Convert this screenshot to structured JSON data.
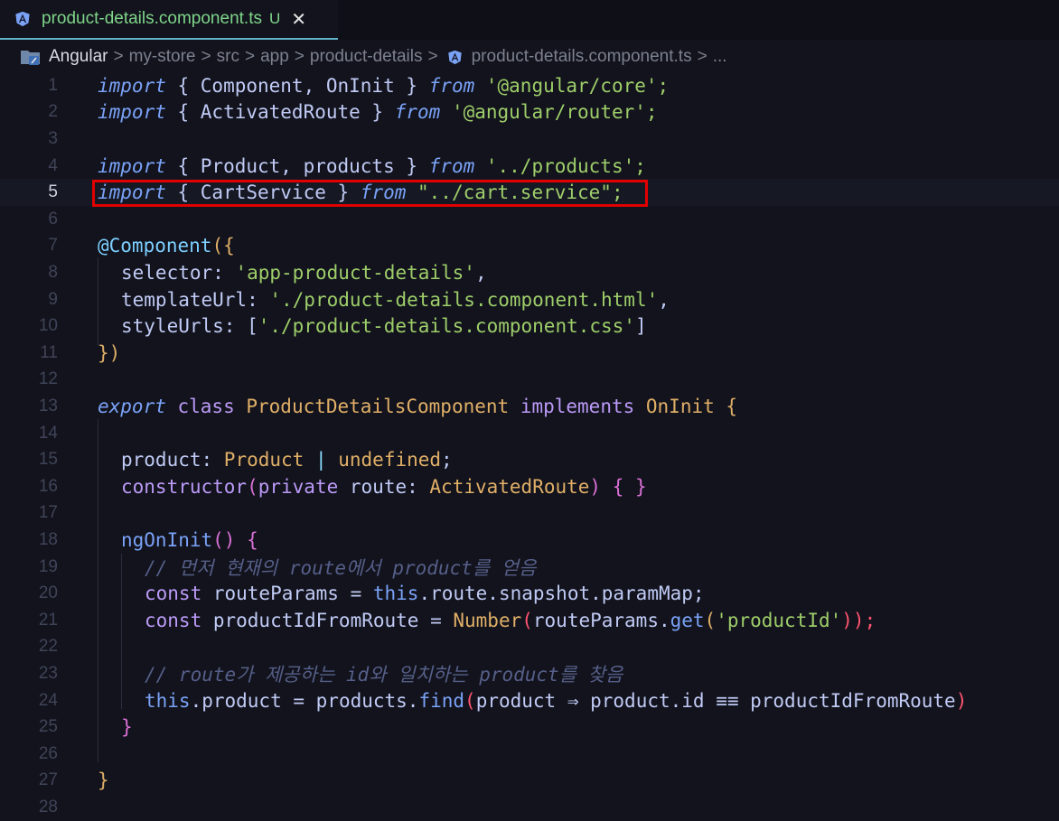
{
  "tab": {
    "filename": "product-details.component.ts",
    "status": "U",
    "close_glyph": "✕"
  },
  "breadcrumb": {
    "items": [
      "Angular",
      "my-store",
      "src",
      "app",
      "product-details",
      "product-details.component.ts",
      "..."
    ],
    "separator": ">"
  },
  "line_numbers": [
    "1",
    "2",
    "3",
    "4",
    "5",
    "6",
    "7",
    "8",
    "9",
    "10",
    "11",
    "12",
    "13",
    "14",
    "15",
    "16",
    "17",
    "18",
    "19",
    "20",
    "21",
    "22",
    "23",
    "24",
    "25",
    "26",
    "27",
    "28"
  ],
  "active_line": "5",
  "code": {
    "l1": [
      "import",
      " { Component, OnInit } ",
      "from",
      " '@angular/core';"
    ],
    "l2": [
      "import",
      " { ActivatedRoute } ",
      "from",
      " '@angular/router';"
    ],
    "l4": [
      "import",
      " { Product, products } ",
      "from",
      " '../products';"
    ],
    "l5": [
      "import",
      " { CartService } ",
      "from",
      " \"../cart.service\";"
    ],
    "l7": [
      "@Component",
      "({"
    ],
    "l8": [
      "selector: ",
      "'app-product-details'",
      ","
    ],
    "l9": [
      "templateUrl: ",
      "'./product-details.component.html'",
      ","
    ],
    "l10": [
      "styleUrls: [",
      "'./product-details.component.css'",
      "]"
    ],
    "l11": [
      "})"
    ],
    "l13": [
      "export",
      " class ",
      "ProductDetailsComponent",
      " implements ",
      "OnInit",
      " {"
    ],
    "l15": [
      "product: ",
      "Product",
      " | ",
      "undefined",
      ";"
    ],
    "l16": [
      "constructor",
      "(",
      "private",
      " route: ",
      "ActivatedRoute",
      ") { }"
    ],
    "l18": [
      "ngOnInit",
      "() {"
    ],
    "l19": [
      "// 먼저 현재의 route에서 product를 얻음"
    ],
    "l20": [
      "const",
      " routeParams = ",
      "this",
      ".route.snapshot.paramMap;"
    ],
    "l21": [
      "const",
      " productIdFromRoute = ",
      "Number",
      "(",
      "routeParams.",
      "get",
      "(",
      "'productId'",
      "));"
    ],
    "l23": [
      "// route가 제공하는 id와 일치하는 product를 찾음"
    ],
    "l24": [
      "this",
      ".product = products.",
      "find",
      "(",
      "product ⇒ product.id ≡≡ productIdFromRoute",
      ")"
    ],
    "l25": [
      "}"
    ],
    "l27": [
      "}"
    ]
  },
  "colors": {
    "highlight_box": "#e00000",
    "tab_underline": "#5fb3c8",
    "modified_file": "#7fd58a"
  },
  "icons": [
    "angular-icon",
    "folder-icon",
    "close-icon"
  ]
}
